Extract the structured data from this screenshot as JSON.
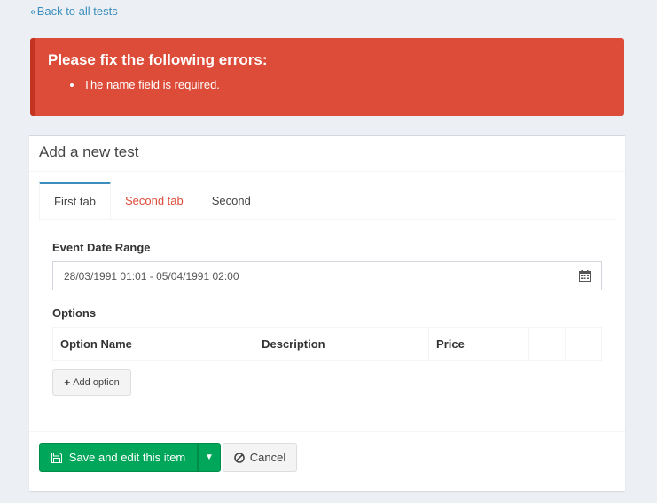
{
  "nav": {
    "back_label": "Back to all tests"
  },
  "alert": {
    "title": "Please fix the following errors:",
    "errors": [
      "The name field is required."
    ],
    "color": "#dd4b39"
  },
  "box": {
    "title": "Add a new test",
    "tabs": [
      {
        "label": "First tab",
        "active": true,
        "has_error": false
      },
      {
        "label": "Second tab",
        "active": false,
        "has_error": true
      },
      {
        "label": "Second",
        "active": false,
        "has_error": false
      }
    ]
  },
  "form": {
    "event_date_range_label": "Event Date Range",
    "event_date_range_value": "28/03/1991 01:01 - 05/04/1991 02:00",
    "options_label": "Options",
    "options_columns": [
      "Option Name",
      "Description",
      "Price",
      "",
      ""
    ],
    "add_option_label": "Add option"
  },
  "actions": {
    "save_label": "Save and edit this item",
    "cancel_label": "Cancel"
  },
  "colors": {
    "link": "#3c8dbc",
    "success": "#00a65a",
    "danger": "#dd4b39"
  },
  "icons": {
    "back": "double-chevron-left-icon",
    "calendar": "calendar-icon",
    "plus": "plus-icon",
    "save": "floppy-disk-icon",
    "caret": "caret-down-icon",
    "cancel": "ban-icon"
  }
}
